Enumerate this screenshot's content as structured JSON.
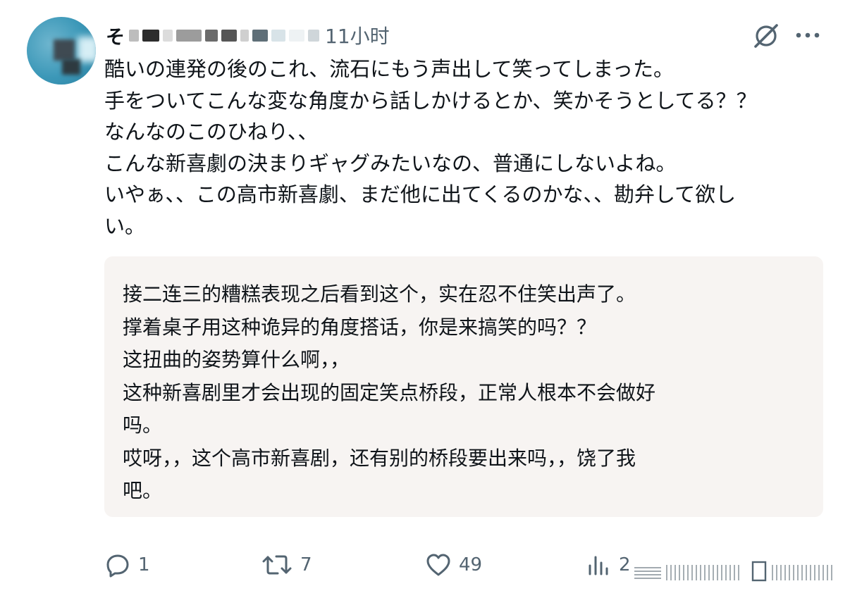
{
  "post": {
    "author_initial": "そ",
    "time": "11小时",
    "lines": [
      "酷いの連発の後のこれ、流石にもう声出して笑ってしまった。",
      "手をついてこんな変な角度から話しかけるとか、笑かそうとしてる？？",
      "なんなのこのひねり、、",
      "こんな新喜劇の決まりギャグみたいなの、普通にしないよね。",
      "いやぁ、、この高市新喜劇、まだ他に出てくるのかな、、勘弁して欲し",
      "い。"
    ]
  },
  "translation": {
    "lines": [
      "接二连三的糟糕表现之后看到这个，实在忍不住笑出声了。",
      "撑着桌子用这种诡异的角度搭话，你是来搞笑的吗？？",
      "这扭曲的姿势算什么啊，，",
      "这种新喜剧里才会出现的固定笑点桥段，正常人根本不会做好",
      "吗。",
      "哎呀，，这个高市新喜剧，还有别的桥段要出来吗，，饶了我",
      "吧。"
    ]
  },
  "actions": {
    "reply_count": "1",
    "repost_count": "7",
    "like_count": "49",
    "views_count": "2"
  },
  "icons": {
    "reply": "reply-icon",
    "repost": "repost-icon",
    "like": "heart-icon",
    "views": "views-icon",
    "grok": "grok-icon",
    "more": "more-icon"
  },
  "colors": {
    "text": "#0f1419",
    "muted": "#536471",
    "translation_bg": "#f7f4f2"
  }
}
